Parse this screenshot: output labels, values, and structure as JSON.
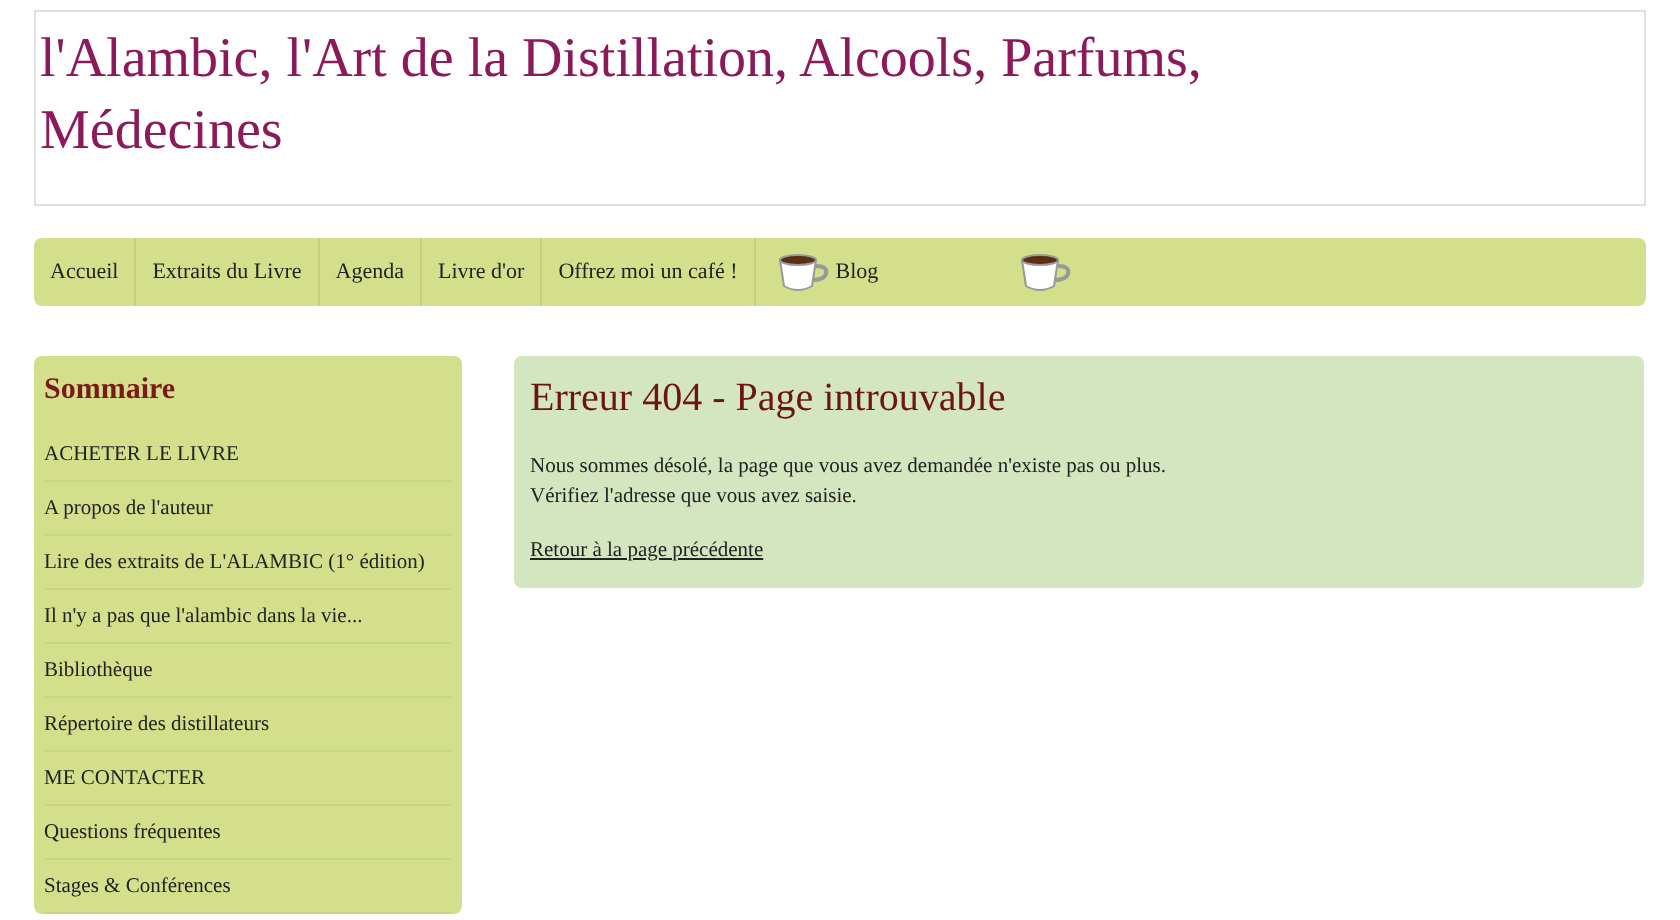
{
  "site_title": "l'Alambic, l'Art de la Distillation, Alcools, Parfums, Médecines",
  "nav": [
    {
      "label": "Accueil",
      "kind": "link"
    },
    {
      "label": "Extraits du Livre",
      "kind": "link"
    },
    {
      "label": "Agenda",
      "kind": "link"
    },
    {
      "label": "Livre d'or",
      "kind": "link"
    },
    {
      "label": "Offrez moi un café !",
      "kind": "link"
    },
    {
      "label": "Blog",
      "kind": "cup-link"
    }
  ],
  "sidebar": {
    "title": "Sommaire",
    "items": [
      "ACHETER LE LIVRE",
      "A propos de l'auteur",
      "Lire des extraits de L'ALAMBIC (1° édition)",
      "Il n'y a pas que l'alambic dans la vie...",
      "Bibliothèque",
      "Répertoire des distillateurs",
      "ME CONTACTER",
      "Questions fréquentes",
      "Stages & Conférences"
    ]
  },
  "error": {
    "title": "Erreur 404 - Page introuvable",
    "lines": [
      "Nous sommes désolé, la page que vous avez demandée n'existe pas ou plus.",
      "Vérifiez l'adresse que vous avez saisie."
    ],
    "back_link": "Retour à la page précédente"
  }
}
